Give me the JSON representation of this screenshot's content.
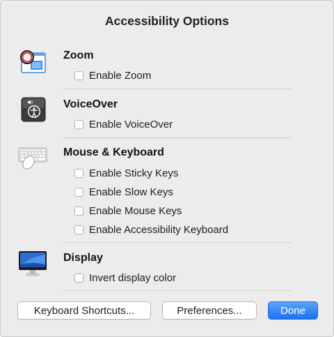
{
  "dialog": {
    "title": "Accessibility Options"
  },
  "sections": {
    "zoom": {
      "heading": "Zoom",
      "icon": "zoom-magnifier-icon",
      "options": [
        "Enable Zoom"
      ]
    },
    "voiceover": {
      "heading": "VoiceOver",
      "icon": "voiceover-icon",
      "options": [
        "Enable VoiceOver"
      ]
    },
    "mouse_keyboard": {
      "heading": "Mouse & Keyboard",
      "icon": "keyboard-mouse-icon",
      "options": [
        "Enable Sticky Keys",
        "Enable Slow Keys",
        "Enable Mouse Keys",
        "Enable Accessibility Keyboard"
      ]
    },
    "display": {
      "heading": "Display",
      "icon": "display-monitor-icon",
      "options": [
        "Invert display color"
      ]
    }
  },
  "buttons": {
    "keyboard_shortcuts": "Keyboard Shortcuts...",
    "preferences": "Preferences...",
    "done": "Done"
  },
  "colors": {
    "accent": "#1c72f0",
    "dialog_background": "#ececec"
  }
}
